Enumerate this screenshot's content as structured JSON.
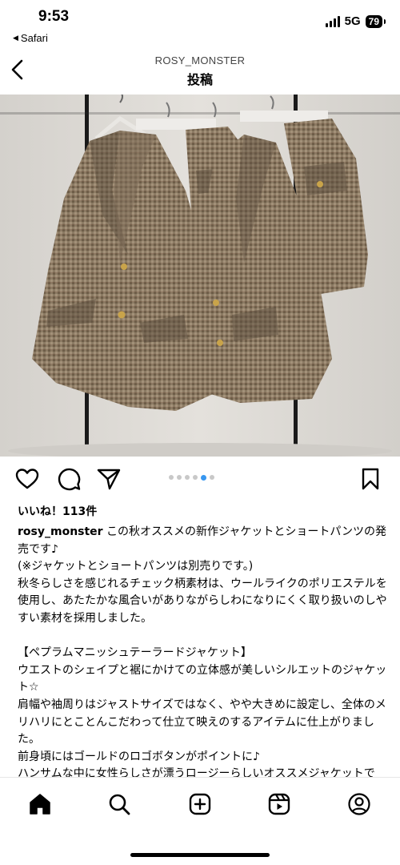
{
  "status": {
    "time": "9:53",
    "back_app": "Safari",
    "network": "5G",
    "battery": "79"
  },
  "header": {
    "username": "ROSY_MONSTER",
    "title": "投稿"
  },
  "post": {
    "image_alt": "Plaid peplum jackets and shorts on hangers",
    "carousel": {
      "count": 6,
      "active": 4
    },
    "likes": "いいね！113件",
    "caption_user": "rosy_monster",
    "caption_first": " この秋オススメの新作ジャケットとショートパンツの発売です♪",
    "caption_lines": [
      "(※ジャケットとショートパンツは別売りです。)",
      "秋冬らしさを感じれるチェック柄素材は、ウールライクのポリエステルを使用し、あたたかな風合いがありながらしわになりにくく取り扱いのしやすい素材を採用しました。",
      "",
      "【ペプラムマニッシュテーラードジャケット】",
      "ウエストのシェイプと裾にかけての立体感が美しいシルエットのジャケット☆",
      "肩幅や袖周りはジャストサイズではなく、やや大きめに設定し、全体のメリハリにとことんこだわって仕立て映えのするアイテムに仕上がりました。",
      "前身頃にはゴールドのロゴボタンがポイントに♪",
      "ハンサムな中に女性らしさが漂うロージーらしいオススメジャケットです。"
    ]
  },
  "icons": {
    "back": "chevron-left-icon",
    "like": "heart-icon",
    "comment": "comment-icon",
    "share": "send-icon",
    "save": "bookmark-icon",
    "nav": [
      "home-icon",
      "search-icon",
      "create-icon",
      "reels-icon",
      "profile-icon"
    ]
  },
  "colors": {
    "accent": "#3897f0",
    "text": "#000000"
  }
}
